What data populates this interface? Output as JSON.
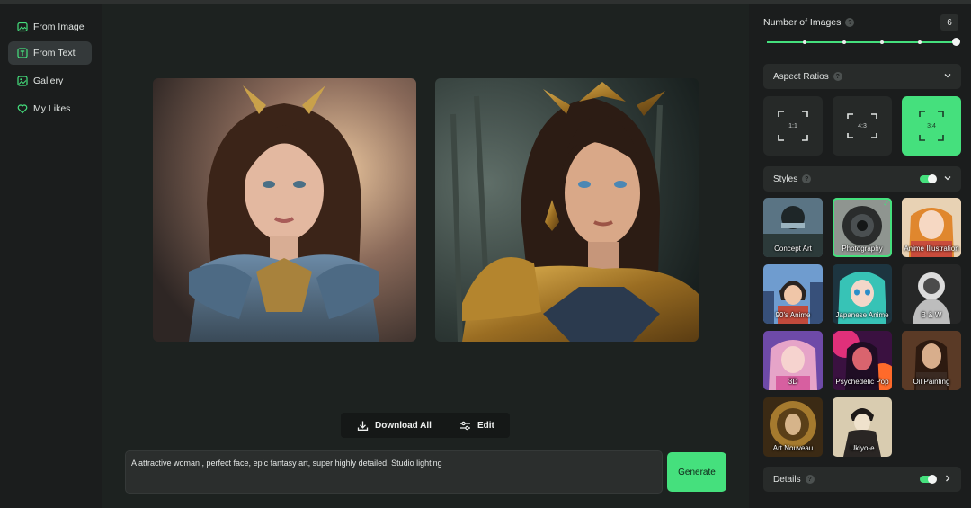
{
  "sidebar": {
    "items": [
      {
        "label": "From Image",
        "icon": "image-icon",
        "active": false
      },
      {
        "label": "From Text",
        "icon": "text-icon",
        "active": true
      },
      {
        "label": "Gallery",
        "icon": "gallery-icon",
        "active": false
      },
      {
        "label": "My Likes",
        "icon": "heart-icon",
        "active": false
      }
    ]
  },
  "main": {
    "download_all_label": "Download All",
    "edit_label": "Edit",
    "prompt_value": "A attractive woman , perfect face, epic fantasy art, super highly detailed, Studio lighting",
    "generate_label": "Generate",
    "images": [
      "generated-image-1",
      "generated-image-2"
    ]
  },
  "panel": {
    "number_of_images_label": "Number of Images",
    "number_of_images_value": "6",
    "aspect_ratios_label": "Aspect Ratios",
    "ratios": [
      "1:1",
      "4:3",
      "3:4"
    ],
    "selected_ratio": "3:4",
    "styles_label": "Styles",
    "styles_enabled": true,
    "styles": [
      {
        "label": "Concept Art"
      },
      {
        "label": "Photography",
        "selected": true
      },
      {
        "label": "Anime Illustration"
      },
      {
        "label": "90's Anime"
      },
      {
        "label": "Japanese Anime"
      },
      {
        "label": "B & W"
      },
      {
        "label": "3D"
      },
      {
        "label": "Psychedelic Pop"
      },
      {
        "label": "Oil Painting"
      },
      {
        "label": "Art Nouveau"
      },
      {
        "label": "Ukiyo-e"
      }
    ],
    "details_label": "Details",
    "details_enabled": true
  },
  "colors": {
    "accent": "#45e07d",
    "sidebar_bg": "#1b1d1d",
    "main_bg": "#1d2220",
    "card_bg": "#282b2a"
  }
}
